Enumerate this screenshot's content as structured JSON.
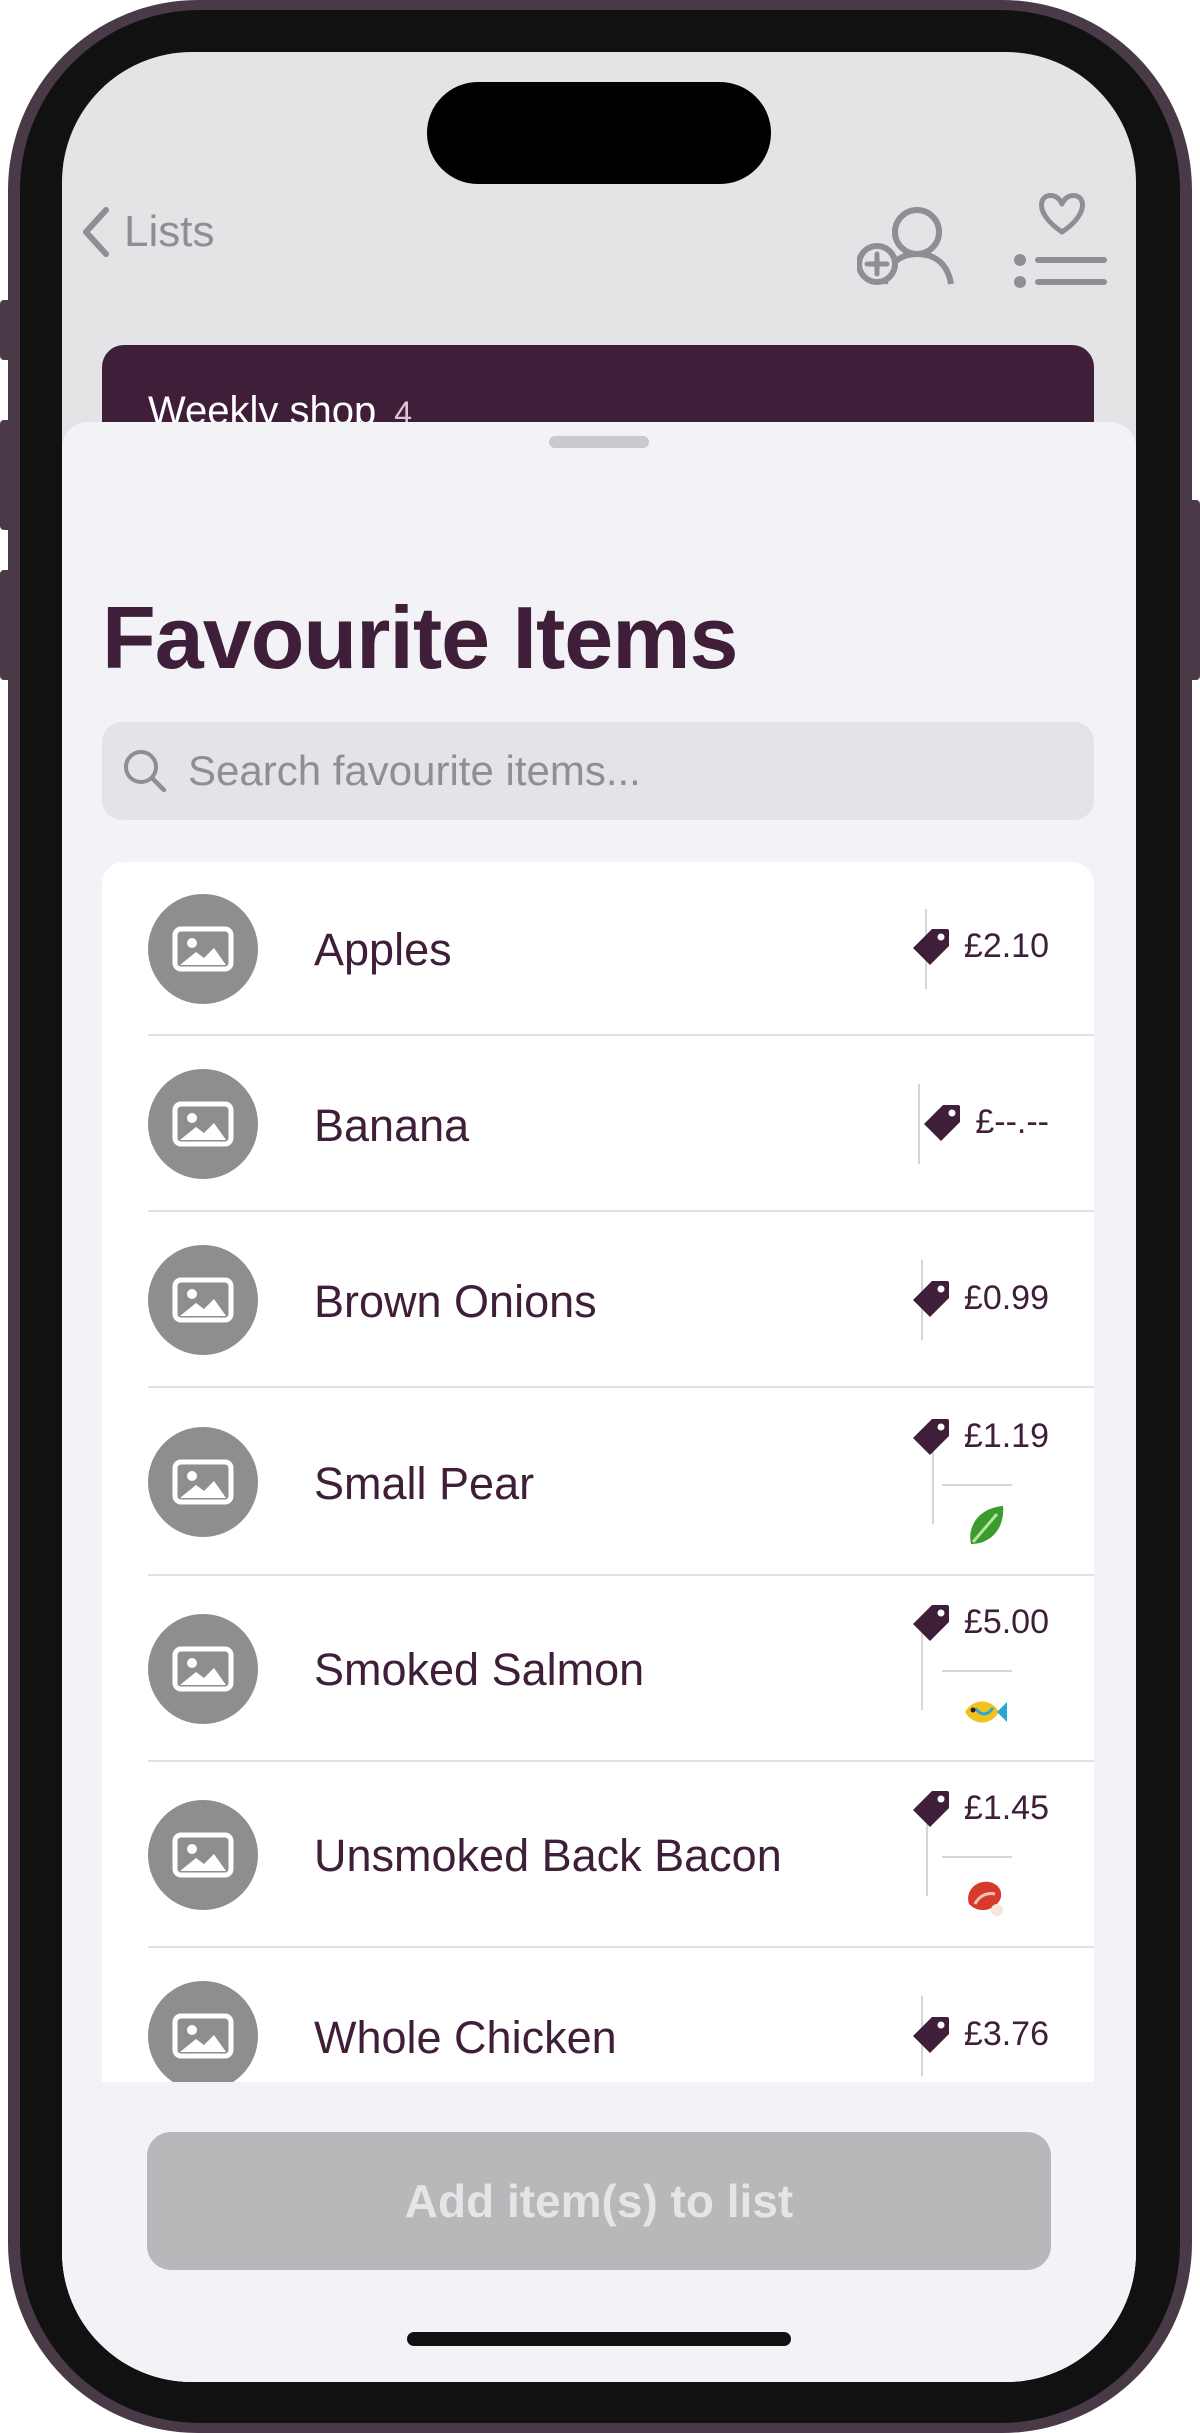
{
  "nav": {
    "back_label": "Lists"
  },
  "list_card": {
    "title": "Weekly shop",
    "count": "4"
  },
  "sheet": {
    "title": "Favourite Items",
    "search_placeholder": "Search favourite items..."
  },
  "items": [
    {
      "name": "Apples",
      "price": "£2.10",
      "category_icon": ""
    },
    {
      "name": "Banana",
      "price": "£--.--",
      "category_icon": ""
    },
    {
      "name": "Brown Onions",
      "price": "£0.99",
      "category_icon": ""
    },
    {
      "name": "Small Pear",
      "price": "£1.19",
      "category_icon": "leafy-green-icon"
    },
    {
      "name": "Smoked Salmon",
      "price": "£5.00",
      "category_icon": "fish-icon"
    },
    {
      "name": "Unsmoked Back Bacon",
      "price": "£1.45",
      "category_icon": "meat-icon"
    },
    {
      "name": "Whole Chicken",
      "price": "£3.76",
      "category_icon": ""
    }
  ],
  "footer": {
    "add_button_label": "Add item(s) to list"
  },
  "colors": {
    "brand": "#3e1e38",
    "sheet_background": "#f2f2f7",
    "disabled_button": "#b8b8bb"
  }
}
